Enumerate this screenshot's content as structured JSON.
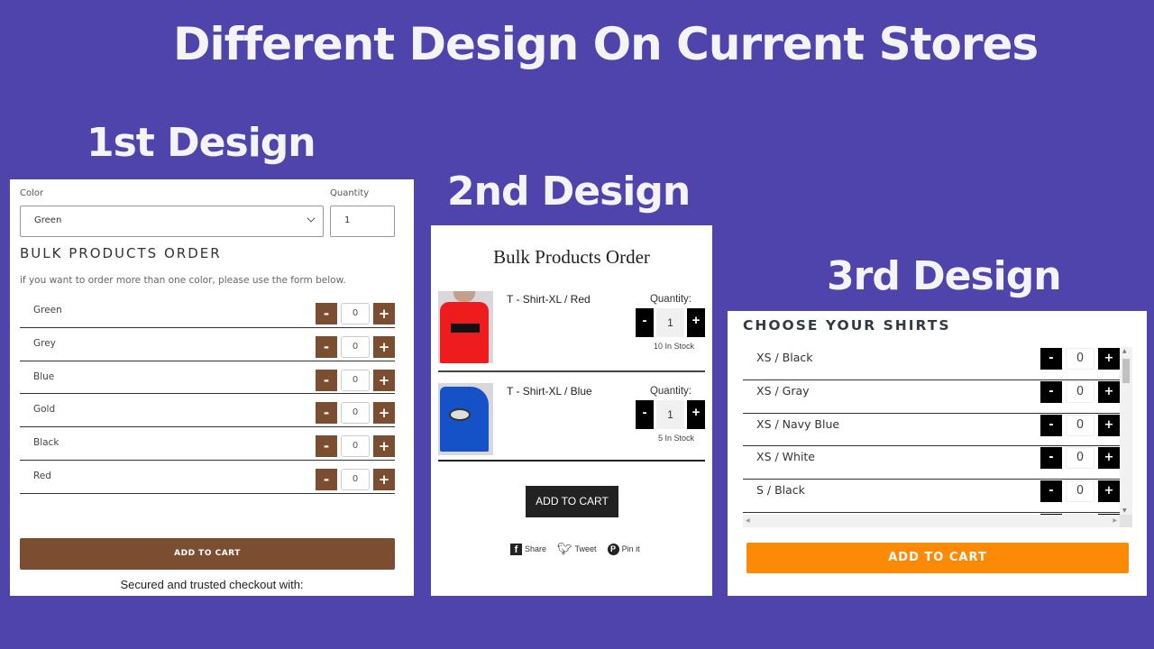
{
  "main_title": "Different Design On Current Stores",
  "design1": {
    "heading": "1st Design",
    "color_label": "Color",
    "quantity_label": "Quantity",
    "color_selected": "Green",
    "quantity_value": "1",
    "bulk_title": "BULK PRODUCTS ORDER",
    "hint": "if you want to order more than one color, please use the form below.",
    "rows": [
      {
        "name": "Green",
        "qty": "0"
      },
      {
        "name": "Grey",
        "qty": "0"
      },
      {
        "name": "Blue",
        "qty": "0"
      },
      {
        "name": "Gold",
        "qty": "0"
      },
      {
        "name": "Black",
        "qty": "0"
      },
      {
        "name": "Red",
        "qty": "0"
      }
    ],
    "minus": "-",
    "plus": "+",
    "add_to_cart": "ADD TO CART",
    "secure_text": "Secured and trusted checkout with:",
    "accent_color": "#7b4e31"
  },
  "design2": {
    "heading": "2nd Design",
    "title": "Bulk Products Order",
    "items": [
      {
        "name": "T - Shirt-XL / Red",
        "qty_label": "Quantity:",
        "qty": "1",
        "stock": "10 In Stock"
      },
      {
        "name": "T - Shirt-XL / Blue",
        "qty_label": "Quantity:",
        "qty": "1",
        "stock": "5 In Stock"
      }
    ],
    "minus": "-",
    "plus": "+",
    "add_to_cart": "ADD TO CART",
    "social": {
      "share": "Share",
      "tweet": "Tweet",
      "pin": "Pin it"
    }
  },
  "design3": {
    "heading": "3rd Design",
    "title": "CHOOSE YOUR SHIRTS",
    "rows": [
      {
        "name": "XS / Black",
        "qty": "0"
      },
      {
        "name": "XS / Gray",
        "qty": "0"
      },
      {
        "name": "XS / Navy Blue",
        "qty": "0"
      },
      {
        "name": "XS / White",
        "qty": "0"
      },
      {
        "name": "S / Black",
        "qty": "0"
      },
      {
        "name": "",
        "qty": ""
      }
    ],
    "minus": "-",
    "plus": "+",
    "add_to_cart": "ADD TO CART",
    "accent_color": "#fd8a07"
  }
}
